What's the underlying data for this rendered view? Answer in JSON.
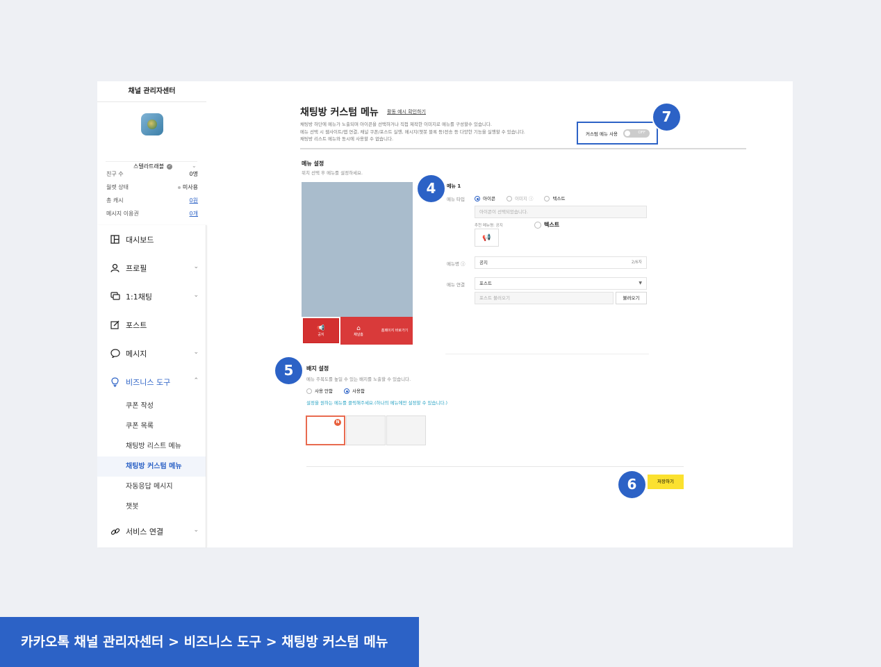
{
  "sidebar": {
    "title": "채널 관리자센터",
    "channel_name": "스텔라트래블",
    "stats": [
      {
        "label": "친구 수",
        "value": "0명"
      },
      {
        "label": "월렛 상태",
        "value": "미사용"
      },
      {
        "label": "총 캐시",
        "value": "0원"
      },
      {
        "label": "메시지 이용권",
        "value": "0개"
      }
    ],
    "menu": {
      "dashboard": "대시보드",
      "profile": "프로필",
      "chat": "1:1채팅",
      "post": "포스트",
      "message": "메시지",
      "business_tools": "비즈니스 도구",
      "service_link": "서비스 연결"
    },
    "submenu": [
      "쿠폰 작성",
      "쿠폰 목록",
      "채팅방 리스트 메뉴",
      "채팅방 커스텀 메뉴",
      "자동응답 메시지",
      "챗봇"
    ]
  },
  "main": {
    "title": "채팅방 커스텀 메뉴",
    "example_link": "활동 예시 확인하기",
    "description": [
      "채팅방 하단에 메뉴가 노출되며 아이콘을 선택하거나 직접 제작한 이미지로 메뉴를 구성할수 있습니다.",
      "메뉴 선택 시 웹사이트/앱 연결, 채널 쿠폰/포스트 실행, 메시지(챗봇 블록 등)전송 등 다양한 기능을 실행할 수 있습니다.",
      "채팅방 리스트 메뉴와 동시에 사용할 수 없습니다."
    ],
    "toggle": {
      "label": "커스텀 메뉴 사용",
      "state": "OFF"
    },
    "menu_settings": {
      "title": "메뉴 설정",
      "subtitle": "위치 선택 후 메뉴를 설정하세요.",
      "preview_cells": [
        {
          "icon": "📢",
          "label": "공지"
        },
        {
          "icon": "⌂",
          "label": "채널홈"
        },
        {
          "icon": "",
          "label": "홈페이지 바로가기"
        }
      ],
      "menu_heading": "메뉴 1",
      "type_label": "메뉴 타입",
      "type_options": [
        "아이콘",
        "이미지",
        "텍스트"
      ],
      "icon_placeholder": "아이콘이 선택되었습니다.",
      "recommend_label": "추천 메뉴명: 공지",
      "text_option": "텍스트",
      "name_label": "메뉴명",
      "name_value": "공지",
      "name_count": "2/6자",
      "link_label": "메뉴 연결",
      "link_value": "포스트",
      "post_placeholder": "포스트 불러오기",
      "load_button": "불러오기"
    },
    "badge_settings": {
      "title": "배지 설정",
      "subtitle": "메뉴 주목도를 높일 수 있는 배지를 노출할 수 있습니다.",
      "options": [
        "사용 안함",
        "사용함"
      ],
      "hint": "설정을 원하는 메뉴를 클릭해주세요.(하나의 메뉴에만 설정할 수 있습니다.)",
      "new_badge": "N"
    },
    "save_button": "저장하기"
  },
  "markers": [
    "7",
    "4",
    "5",
    "6"
  ],
  "footer": "카카오톡 채널 관리자센터 > 비즈니스 도구 > 채팅방 커스텀 메뉴",
  "colors": {
    "accent": "#2c62c6",
    "menu_red": "#d93a3a",
    "save_yellow": "#fbe12f",
    "hint_blue": "#29a3c4"
  }
}
